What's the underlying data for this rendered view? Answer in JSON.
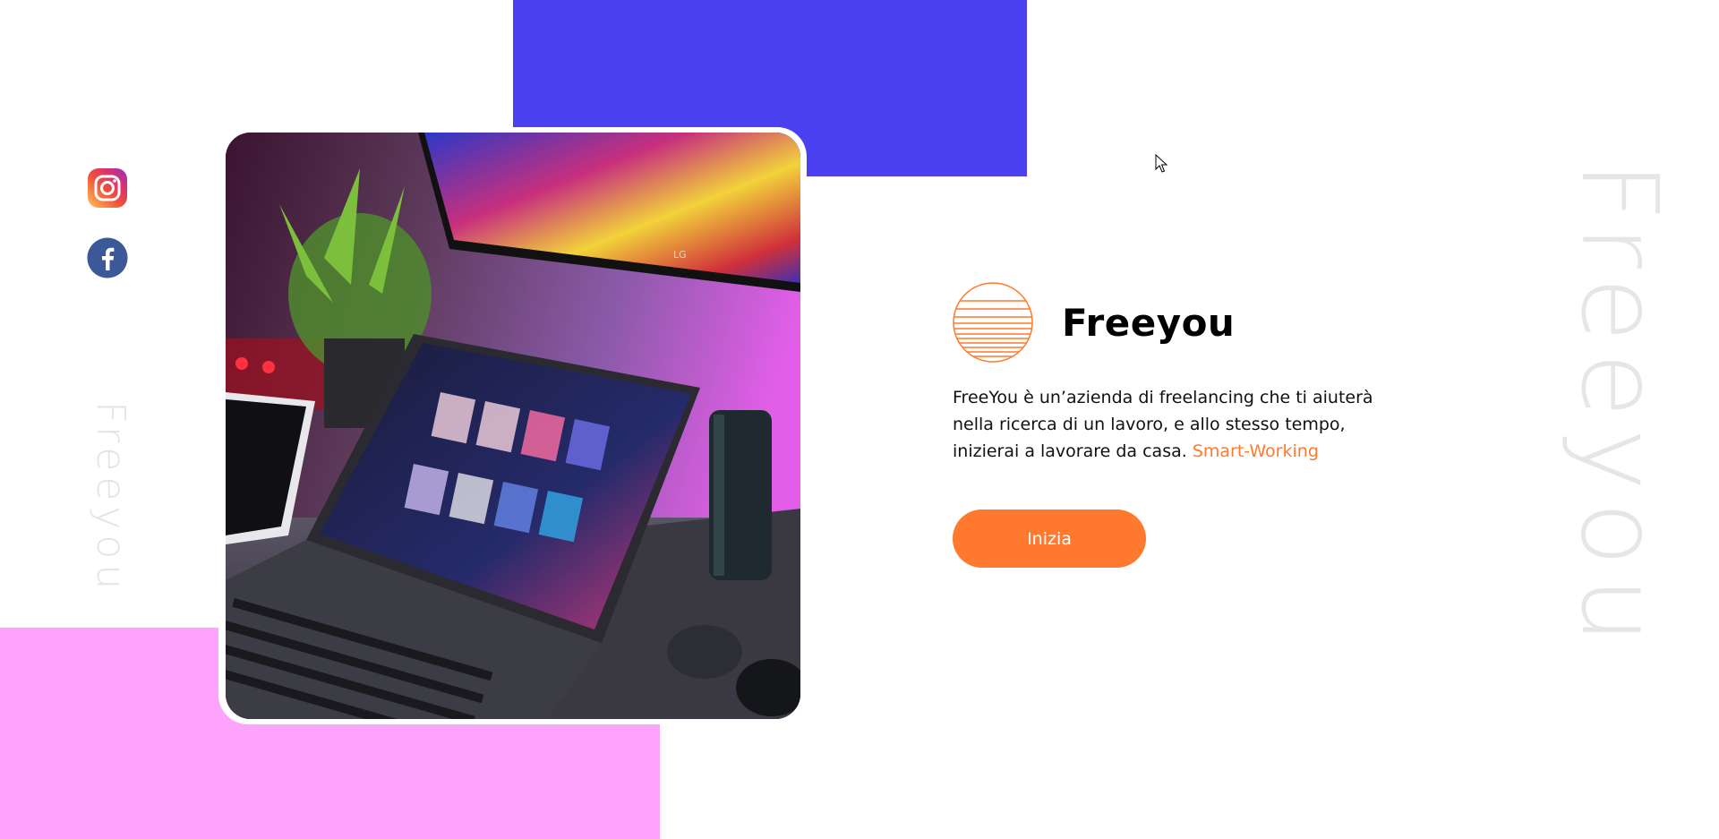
{
  "social": {
    "instagram_icon": "instagram-icon",
    "facebook_icon": "facebook-icon"
  },
  "side_text": "Freeyou",
  "watermark_text": "Freeyou",
  "brand": {
    "title": "Freeyou",
    "logo_icon": "striped-sun-logo"
  },
  "description": {
    "text": "FreeYou è un’azienda di freelancing che ti aiuterà nella ricerca di un lavoro, e allo stesso tempo, inizierai a lavorare da casa. ",
    "highlight": "Smart-Working"
  },
  "cta": {
    "label": "Inizia"
  },
  "colors": {
    "accent": "#ff7a2e",
    "blue_block": "#4a40ef",
    "pink_block": "#fea3fc",
    "watermark": "#e6e6e6"
  }
}
